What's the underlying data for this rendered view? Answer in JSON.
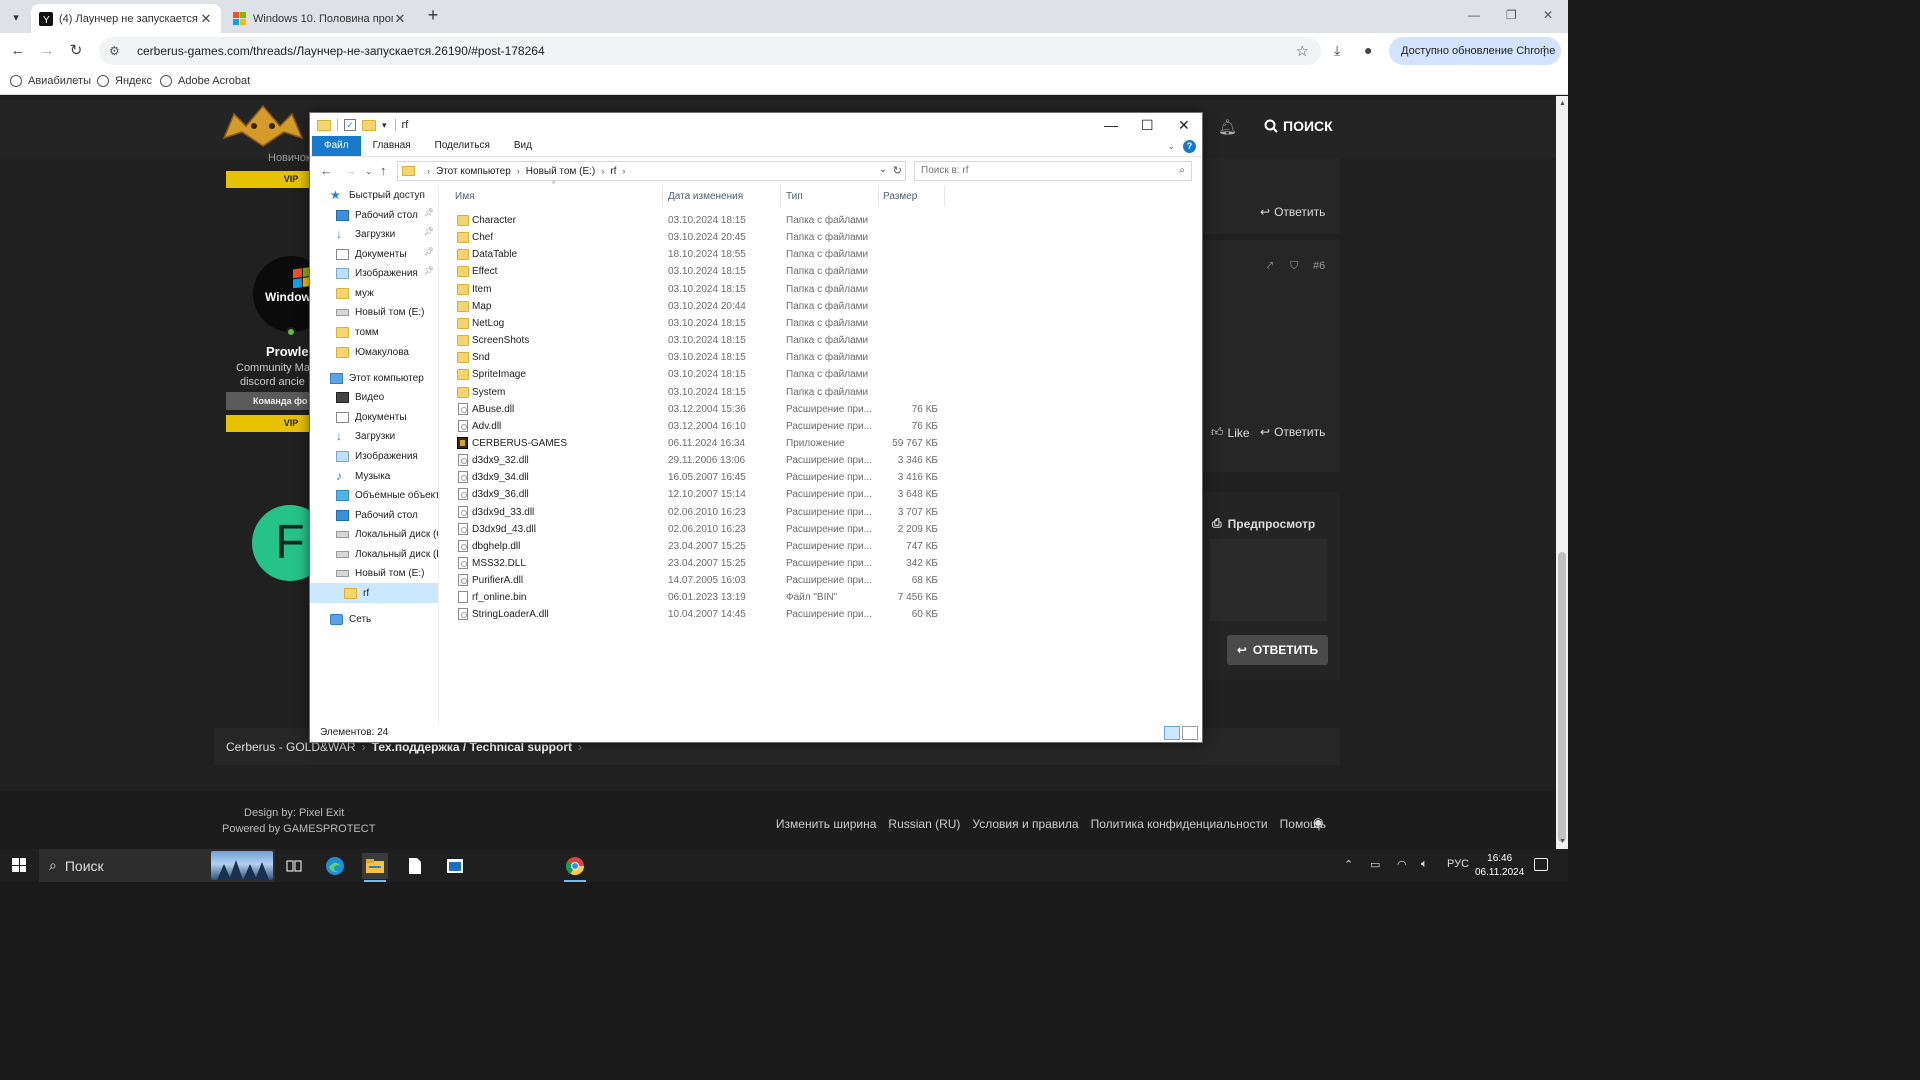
{
  "browser": {
    "tabs": [
      {
        "title": "(4) Лаунчер не запускается | C",
        "active": true
      },
      {
        "title": "Windows 10. Половина програ",
        "active": false
      }
    ],
    "url": "cerberus-games.com/threads/Лаунчер-не-запускается.26190/#post-178264",
    "update_label": "Доступно обновление Chrome",
    "bookmarks": [
      "Авиабилеты",
      "Яндекс",
      "Adobe Acrobat"
    ]
  },
  "forum": {
    "search_label": "ПОИСК",
    "user1": {
      "rank": "Новичок",
      "vip": "VIP"
    },
    "user2": {
      "avatar_text": "Windows",
      "name": "Prowle",
      "title1": "Community Ma",
      "title2": "discord ancie",
      "team": "Команда фо",
      "vip": "VIP"
    },
    "user3": {
      "avatar_letter": "F"
    },
    "reply": "Ответить",
    "like": "Like",
    "post_number": "#6",
    "preview": "Предпросмотр",
    "reply_button": "ОТВЕТИТЬ",
    "breadcrumb": [
      "Cerberus - GOLD&WAR",
      "Тех.поддержка / Technical support"
    ],
    "footer": {
      "design": "Design by: Pixel Exit",
      "powered": "Powered by GAMESPROTECT",
      "links": [
        "Изменить ширина",
        "Russian (RU)",
        "Условия и правила",
        "Политика конфиденциальности",
        "Помощь"
      ]
    }
  },
  "explorer": {
    "title": "rf",
    "ribbon_tabs": [
      "Файл",
      "Главная",
      "Поделиться",
      "Вид"
    ],
    "address": [
      "Этот компьютер",
      "Новый том (E:)",
      "rf"
    ],
    "search_placeholder": "Поиск в: rf",
    "columns": [
      "Имя",
      "Дата изменения",
      "Тип",
      "Размер"
    ],
    "nav": [
      {
        "label": "Быстрый доступ",
        "icon": "star",
        "indent": 0,
        "pinned": false
      },
      {
        "label": "Рабочий стол",
        "icon": "desk",
        "indent": 1,
        "pinned": true
      },
      {
        "label": "Загрузки",
        "icon": "down",
        "indent": 1,
        "pinned": true
      },
      {
        "label": "Документы",
        "icon": "doc",
        "indent": 1,
        "pinned": true
      },
      {
        "label": "Изображения",
        "icon": "img",
        "indent": 1,
        "pinned": true
      },
      {
        "label": "муж",
        "icon": "fold",
        "indent": 1,
        "pinned": false
      },
      {
        "label": "Новый том (E:)",
        "icon": "drive",
        "indent": 1,
        "pinned": false
      },
      {
        "label": "томм",
        "icon": "fold",
        "indent": 1,
        "pinned": false
      },
      {
        "label": "Юмакулова",
        "icon": "fold",
        "indent": 1,
        "pinned": false
      },
      {
        "label": "Этот компьютер",
        "icon": "pc",
        "indent": 0,
        "pinned": false
      },
      {
        "label": "Видео",
        "icon": "vid",
        "indent": 1,
        "pinned": false
      },
      {
        "label": "Документы",
        "icon": "doc",
        "indent": 1,
        "pinned": false
      },
      {
        "label": "Загрузки",
        "icon": "down",
        "indent": 1,
        "pinned": false
      },
      {
        "label": "Изображения",
        "icon": "img",
        "indent": 1,
        "pinned": false
      },
      {
        "label": "Музыка",
        "icon": "mus",
        "indent": 1,
        "pinned": false
      },
      {
        "label": "Объемные объекты",
        "icon": "obj",
        "indent": 1,
        "pinned": false
      },
      {
        "label": "Рабочий стол",
        "icon": "desk",
        "indent": 1,
        "pinned": false
      },
      {
        "label": "Локальный диск (C",
        "icon": "drive",
        "indent": 1,
        "pinned": false
      },
      {
        "label": "Локальный диск (D",
        "icon": "drive",
        "indent": 1,
        "pinned": false
      },
      {
        "label": "Новый том (E:)",
        "icon": "drive",
        "indent": 1,
        "pinned": false
      },
      {
        "label": "rf",
        "icon": "fold",
        "indent": 2,
        "pinned": false,
        "selected": true
      },
      {
        "label": "Сеть",
        "icon": "net",
        "indent": 0,
        "pinned": false
      }
    ],
    "files": [
      {
        "name": "Character",
        "date": "03.10.2024 18:15",
        "type": "Папка с файлами",
        "size": "",
        "icon": "folder"
      },
      {
        "name": "Chef",
        "date": "03.10.2024 20:45",
        "type": "Папка с файлами",
        "size": "",
        "icon": "folder"
      },
      {
        "name": "DataTable",
        "date": "18.10.2024 18:55",
        "type": "Папка с файлами",
        "size": "",
        "icon": "folder"
      },
      {
        "name": "Effect",
        "date": "03.10.2024 18:15",
        "type": "Папка с файлами",
        "size": "",
        "icon": "folder"
      },
      {
        "name": "Item",
        "date": "03.10.2024 18:15",
        "type": "Папка с файлами",
        "size": "",
        "icon": "folder"
      },
      {
        "name": "Map",
        "date": "03.10.2024 20:44",
        "type": "Папка с файлами",
        "size": "",
        "icon": "folder"
      },
      {
        "name": "NetLog",
        "date": "03.10.2024 18:15",
        "type": "Папка с файлами",
        "size": "",
        "icon": "folder"
      },
      {
        "name": "ScreenShots",
        "date": "03.10.2024 18:15",
        "type": "Папка с файлами",
        "size": "",
        "icon": "folder"
      },
      {
        "name": "Snd",
        "date": "03.10.2024 18:15",
        "type": "Папка с файлами",
        "size": "",
        "icon": "folder"
      },
      {
        "name": "SpriteImage",
        "date": "03.10.2024 18:15",
        "type": "Папка с файлами",
        "size": "",
        "icon": "folder"
      },
      {
        "name": "System",
        "date": "03.10.2024 18:15",
        "type": "Папка с файлами",
        "size": "",
        "icon": "folder"
      },
      {
        "name": "ABuse.dll",
        "date": "03.12.2004 15:36",
        "type": "Расширение при...",
        "size": "76 КБ",
        "icon": "dll"
      },
      {
        "name": "Adv.dll",
        "date": "03.12.2004 16:10",
        "type": "Расширение при...",
        "size": "76 КБ",
        "icon": "dll"
      },
      {
        "name": "CERBERUS-GAMES",
        "date": "06.11.2024 16:34",
        "type": "Приложение",
        "size": "59 767 КБ",
        "icon": "app"
      },
      {
        "name": "d3dx9_32.dll",
        "date": "29.11.2006 13:06",
        "type": "Расширение при...",
        "size": "3 346 КБ",
        "icon": "dll"
      },
      {
        "name": "d3dx9_34.dll",
        "date": "16.05.2007 16:45",
        "type": "Расширение при...",
        "size": "3 416 КБ",
        "icon": "dll"
      },
      {
        "name": "d3dx9_36.dll",
        "date": "12.10.2007 15:14",
        "type": "Расширение при...",
        "size": "3 648 КБ",
        "icon": "dll"
      },
      {
        "name": "d3dx9d_33.dll",
        "date": "02.06.2010 16:23",
        "type": "Расширение при...",
        "size": "3 707 КБ",
        "icon": "dll"
      },
      {
        "name": "D3dx9d_43.dll",
        "date": "02.06.2010 16:23",
        "type": "Расширение при...",
        "size": "2 209 КБ",
        "icon": "dll"
      },
      {
        "name": "dbghelp.dll",
        "date": "23.04.2007 15:25",
        "type": "Расширение при...",
        "size": "747 КБ",
        "icon": "dll"
      },
      {
        "name": "MSS32.DLL",
        "date": "23.04.2007 15:25",
        "type": "Расширение при...",
        "size": "342 КБ",
        "icon": "dll"
      },
      {
        "name": "PurifierA.dll",
        "date": "14.07.2005 16:03",
        "type": "Расширение при...",
        "size": "68 КБ",
        "icon": "dll"
      },
      {
        "name": "rf_online.bin",
        "date": "06.01.2023 13:19",
        "type": "Файл \"BIN\"",
        "size": "7 456 КБ",
        "icon": "bin"
      },
      {
        "name": "StringLoaderA.dll",
        "date": "10.04.2007 14:45",
        "type": "Расширение при...",
        "size": "60 КБ",
        "icon": "dll"
      }
    ],
    "status": "Элементов: 24"
  },
  "taskbar": {
    "search_label": "Поиск",
    "lang": "РУС",
    "time": "16:46",
    "date": "06.11.2024"
  }
}
